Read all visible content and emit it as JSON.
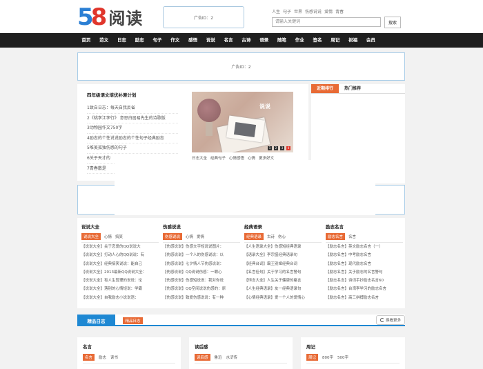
{
  "header": {
    "logo_num_5": "5",
    "logo_num_8": "8",
    "logo_text": "阅读",
    "ad_label": "广告ID：2",
    "hotwords": [
      "人生",
      "句子",
      "世界",
      "伤感说说",
      "爱情",
      "青春"
    ],
    "search_placeholder": "请输入关键词",
    "search_button": "搜索"
  },
  "nav": [
    "首页",
    "范文",
    "日志",
    "励志",
    "句子",
    "作文",
    "感悟",
    "说说",
    "名言",
    "古诗",
    "语录",
    "随笔",
    "作业",
    "签名",
    "周记",
    "祝福",
    "会员"
  ],
  "ad_banner": "广告ID：2",
  "featured": {
    "title": "四年级语文培优补差计划",
    "items": [
      "1致自日志：每天自我反省",
      "2《桃李江李行》 意思白居易先生的诗歌版",
      "3动物园作文750字",
      "4励志的个性说说励志的个性句子经典励志",
      "5唯美孤独伤感的句子",
      "6关于天才的",
      "7青春散是"
    ],
    "image_caption": "说说",
    "image_dots": [
      "1",
      "2",
      "3",
      "4"
    ],
    "links": [
      "日志大全",
      "经典句子",
      "心情感悟",
      "心情",
      "更多好文"
    ]
  },
  "rank": {
    "tabs": [
      "近期排行",
      "热门推荐"
    ]
  },
  "columns": [
    {
      "title": "说说大全",
      "tags": [
        "说说大全",
        "心情",
        "搞笑"
      ],
      "items": [
        "【说说大全】关于恋爱的QQ说说大",
        "【说说大全】打动人心的QQ说说：有",
        "【说说大全】经典搞笑说说：能自己",
        "【说说大全】2013最新QQ说说大全：",
        "【说说大全】有人生哲理的说说：论",
        "【说说大全】落别的心情短说：学霸",
        "【说说大全】自我励志小说说语："
      ]
    },
    {
      "title": "伤感说说",
      "tags": [
        "伤感说说",
        "心情",
        "爱情"
      ],
      "items": [
        "【伤感说说】伤感文字短说说图片：",
        "【伤感说说】一个人的伤感说说：以",
        "【伤感说说】七夕情人节伤感说说：",
        "【伤感说说】QQ说说伤感：一颗心",
        "【伤感说说】伤感短说说：我对你说",
        "【伤感说说】QQ空间说说伤感的：原",
        "【伤感说说】致爱伤感说说：有一种"
      ]
    },
    {
      "title": "经典语录",
      "tags": [
        "经典语录",
        "古诗",
        "伤心"
      ],
      "items": [
        "【人生语录大全】伤感短经典语录",
        "【语录大全】李宗盛经典语录句",
        "【经典台词】霸王别姬经典台词",
        "【名言佳句】关于学习的名言警句",
        "【恒言大全】人生关于健康的格言",
        "【人生经典语录】友一经典语录句",
        "【心情经典语录】爱一个人的爱情心"
      ]
    },
    {
      "title": "励志名言",
      "tags": [
        "励志名言",
        "名言"
      ],
      "items": [
        "【励志名言】英文励志名言（一）",
        "【励志名言】中考励志名言",
        "【励志名言】现代励志名言",
        "【励志名言】关于励志的名言警句",
        "【励志名言】诗词手抄励志名言60",
        "【励志名言】台湾李学习的励志名言",
        "【励志名言】高三拼搏励志名言"
      ]
    }
  ],
  "essays": {
    "tab_active": "精品日志",
    "tab_other": "精品日志",
    "refresh_label": "换看更多"
  },
  "bottom_boxes": [
    {
      "title": "名言",
      "tags": [
        "名言",
        "励志",
        "读书"
      ]
    },
    {
      "title": "读后感",
      "tags": [
        "读后感",
        "鲁迅",
        "水浒传"
      ]
    },
    {
      "title": "周记",
      "tags": [
        "周记",
        "800字",
        "500字"
      ]
    }
  ],
  "colors": {
    "nav_bg": "#1f1f1f",
    "accent_orange": "#e86a35",
    "accent_blue": "#1e88d3",
    "logo_blue": "#2b7fd4",
    "logo_red": "#e0362c"
  }
}
